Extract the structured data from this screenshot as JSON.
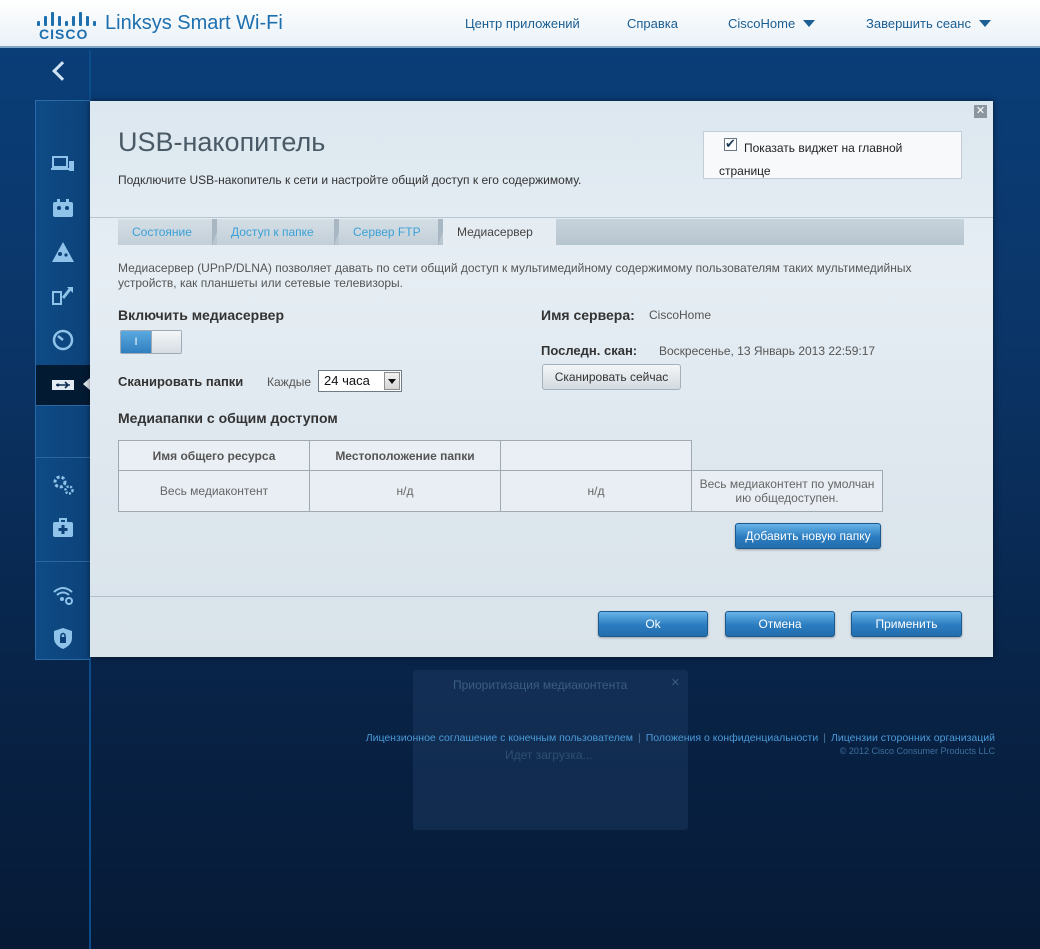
{
  "header": {
    "brand": "CISCO",
    "product": "Linksys Smart Wi-Fi",
    "nav": {
      "apps": "Центр приложений",
      "help": "Справка",
      "router": "CiscoHome",
      "logout": "Завершить сеанс"
    }
  },
  "sidebar": {
    "items": [
      {
        "name": "device-list-icon"
      },
      {
        "name": "guest-access-icon"
      },
      {
        "name": "parental-controls-icon"
      },
      {
        "name": "media-prioritization-icon"
      },
      {
        "name": "speed-test-icon"
      },
      {
        "name": "usb-storage-icon"
      },
      {
        "name": "connectivity-settings-icon"
      },
      {
        "name": "troubleshooting-icon"
      },
      {
        "name": "wireless-icon"
      },
      {
        "name": "security-icon"
      }
    ]
  },
  "background_panel": {
    "title": "Приоритизация медиаконтента",
    "loading": "Идет загрузка..."
  },
  "footer": {
    "eula": "Лицензионное соглашение с конечным пользователем",
    "privacy": "Положения о конфиденциальности",
    "third_party": "Лицензии сторонних организаций",
    "copyright": "© 2012 Cisco Consumer Products LLC"
  },
  "modal": {
    "title": "USB-накопитель",
    "subtitle": "Подключите USB-накопитель к сети и настройте общий доступ к его содержимому.",
    "widget_checkbox": "Показать виджет на главной странице",
    "tabs": [
      "Состояние",
      "Доступ к папке",
      "Сервер FTP",
      "Медиасервер"
    ],
    "description": "Медиасервер (UPnP/DLNA) позволяет давать по сети общий доступ к мультимедийному содержимому пользователям таких мультимедийных устройств, как планшеты или сетевые телевизоры.",
    "enable_label": "Включить медиасервер",
    "toggle_on": "I",
    "scan_label": "Сканировать папки",
    "scan_every": "Каждые",
    "scan_interval": "24 часа",
    "server_name_label": "Имя сервера:",
    "server_name": "CiscoHome",
    "last_scan_label": "Последн. скан:",
    "last_scan": "Воскресенье, 13 Январь 2013 22:59:17",
    "scan_now": "Сканировать сейчас",
    "shared_folders_heading": "Медиапапки с общим доступом",
    "table": {
      "headers": [
        "Имя общего ресурса",
        "Местоположение папки",
        ""
      ],
      "row": [
        "Весь медиаконтент",
        "н/д",
        "н/д",
        "Весь медиаконтент по умолчанию общедоступен."
      ]
    },
    "add_folder": "Добавить новую папку",
    "ok": "Ok",
    "cancel": "Отмена",
    "apply": "Применить",
    "close": "✕"
  }
}
